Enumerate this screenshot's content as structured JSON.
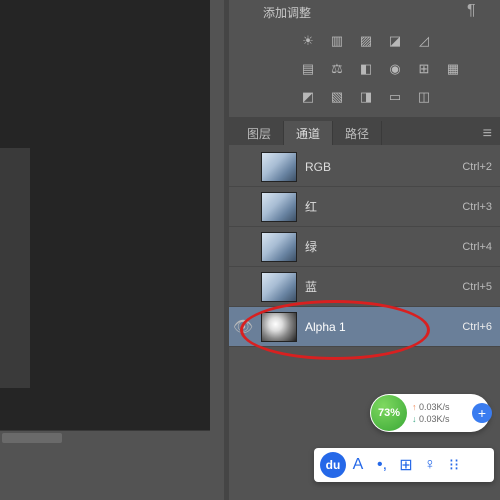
{
  "adjustments": {
    "title": "添加调整"
  },
  "tabs": {
    "layers": "图层",
    "channels": "通道",
    "paths": "路径"
  },
  "channels": [
    {
      "name": "RGB",
      "key": "Ctrl+2",
      "visible": false,
      "selected": false,
      "alpha": false
    },
    {
      "name": "红",
      "key": "Ctrl+3",
      "visible": false,
      "selected": false,
      "alpha": false
    },
    {
      "name": "绿",
      "key": "Ctrl+4",
      "visible": false,
      "selected": false,
      "alpha": false
    },
    {
      "name": "蓝",
      "key": "Ctrl+5",
      "visible": false,
      "selected": false,
      "alpha": false
    },
    {
      "name": "Alpha 1",
      "key": "Ctrl+6",
      "visible": true,
      "selected": true,
      "alpha": true
    }
  ],
  "netmon": {
    "percent": "73%",
    "up": " 0.03K/s",
    "down": " 0.03K/s"
  },
  "baidu": {
    "logo": "du",
    "items": [
      "A",
      "•,",
      "⊞",
      "♀",
      "⁝⁝"
    ]
  }
}
